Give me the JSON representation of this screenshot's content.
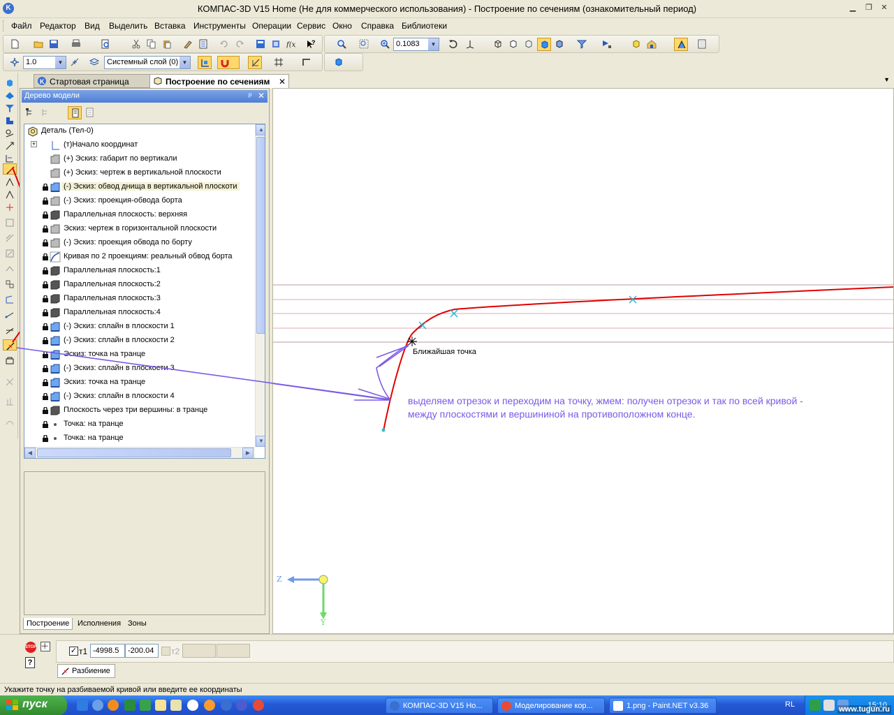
{
  "window": {
    "title": "КОМПАС-3D V15 Home (Не для коммерческого использования) - Построение по сечениям (ознакомительный период)",
    "icon_letter": "K"
  },
  "menu": [
    "Файл",
    "Редактор",
    "Вид",
    "Выделить",
    "Вставка",
    "Инструменты",
    "Операции",
    "Сервис",
    "Окно",
    "Справка",
    "Библиотеки"
  ],
  "toolbar": {
    "zoom_value": "0.1083",
    "step_value": "1.0",
    "layer_value": "Системный слой (0)"
  },
  "tabs": [
    {
      "label": "Стартовая страница",
      "active": false
    },
    {
      "label": "Построение по сечениям",
      "active": true
    }
  ],
  "tab_close": "✕",
  "tabs_dropdown": "▼",
  "tree": {
    "header": "Дерево модели",
    "pin": "ᵖ",
    "close": "✕",
    "root": "Деталь (Тел-0)",
    "expand": "+",
    "items": [
      {
        "label": "(т)Начало координат",
        "lock": false,
        "icon": "axes-icon"
      },
      {
        "label": "(+) Эскиз: габарит по вертикали",
        "lock": false,
        "icon": "sketch-icon"
      },
      {
        "label": "(+) Эскиз: чертеж в вертикальной плоскости",
        "lock": false,
        "icon": "sketch-icon"
      },
      {
        "label": "(-) Эскиз: обвод днища в вертикальной плоскоти",
        "lock": true,
        "icon": "sketch-blue-icon",
        "highlight": true
      },
      {
        "label": "(-) Эскиз: проекция-обвода борта",
        "lock": true,
        "icon": "sketch-icon"
      },
      {
        "label": "Параллельная плоскость: верхняя",
        "lock": true,
        "icon": "plane-icon"
      },
      {
        "label": "Эскиз: чертеж в горизонтальной плоскости",
        "lock": true,
        "icon": "sketch-icon"
      },
      {
        "label": "(-) Эскиз: проекция обвода по борту",
        "lock": true,
        "icon": "sketch-icon"
      },
      {
        "label": "Кривая по 2 проекциям: реальный обвод борта",
        "lock": true,
        "icon": "curve-icon"
      },
      {
        "label": "Параллельная плоскость:1",
        "lock": true,
        "icon": "plane-icon"
      },
      {
        "label": "Параллельная плоскость:2",
        "lock": true,
        "icon": "plane-icon"
      },
      {
        "label": "Параллельная плоскость:3",
        "lock": true,
        "icon": "plane-icon"
      },
      {
        "label": "Параллельная плоскость:4",
        "lock": true,
        "icon": "plane-icon"
      },
      {
        "label": "(-) Эскиз: сплайн в плоскости 1",
        "lock": true,
        "icon": "sketch-blue-icon"
      },
      {
        "label": "(-) Эскиз: сплайн в плоскости 2",
        "lock": true,
        "icon": "sketch-blue-icon"
      },
      {
        "label": "Эскиз: точка на транце",
        "lock": true,
        "icon": "sketch-blue-icon"
      },
      {
        "label": "(-) Эскиз: сплайн в плоскости 3",
        "lock": true,
        "icon": "sketch-blue-icon"
      },
      {
        "label": "Эскиз: точка на транце",
        "lock": true,
        "icon": "sketch-blue-icon"
      },
      {
        "label": "(-) Эскиз: сплайн  в плоскости 4",
        "lock": true,
        "icon": "sketch-blue-icon"
      },
      {
        "label": "Плоскость через три вершины: в транце",
        "lock": true,
        "icon": "plane-icon"
      },
      {
        "label": "Точка: на транце",
        "lock": true,
        "icon": "point-icon"
      },
      {
        "label": "Точка: на транце",
        "lock": true,
        "icon": "point-icon"
      },
      {
        "label": "Точка: на транце",
        "lock": true,
        "icon": "point-icon"
      }
    ],
    "bottom_tabs": [
      "Построение",
      "Исполнения",
      "Зоны"
    ]
  },
  "viewport": {
    "nearest_point_label": "Ближайшая точка",
    "annotation_line1": "выделяем отрезок и переходим на точку, жмем: получен отрезок и так по всей кривой -",
    "annotation_line2": "между плоскостями и вершининой на противоположном конце.",
    "axis_z": "Z",
    "axis_y": "Y",
    "curve_color": "#e00000",
    "annotation_color": "#7b5ae6"
  },
  "properties": {
    "t1_label": "т1",
    "t1_x": "-4998.5",
    "t1_y": "-200.04",
    "t2_label": "т2",
    "tab_label": "Разбиение"
  },
  "status": "Укажите точку на разбиваемой кривой или введите ее координаты",
  "taskbar": {
    "start": "пуск",
    "tasks": [
      "КОМПАС-3D V15 Ho...",
      "Моделирование кор...",
      "1.png - Paint.NET v3.36"
    ],
    "lang": "RL",
    "clock": "15:10",
    "watermark": "www.tugun.ru"
  }
}
